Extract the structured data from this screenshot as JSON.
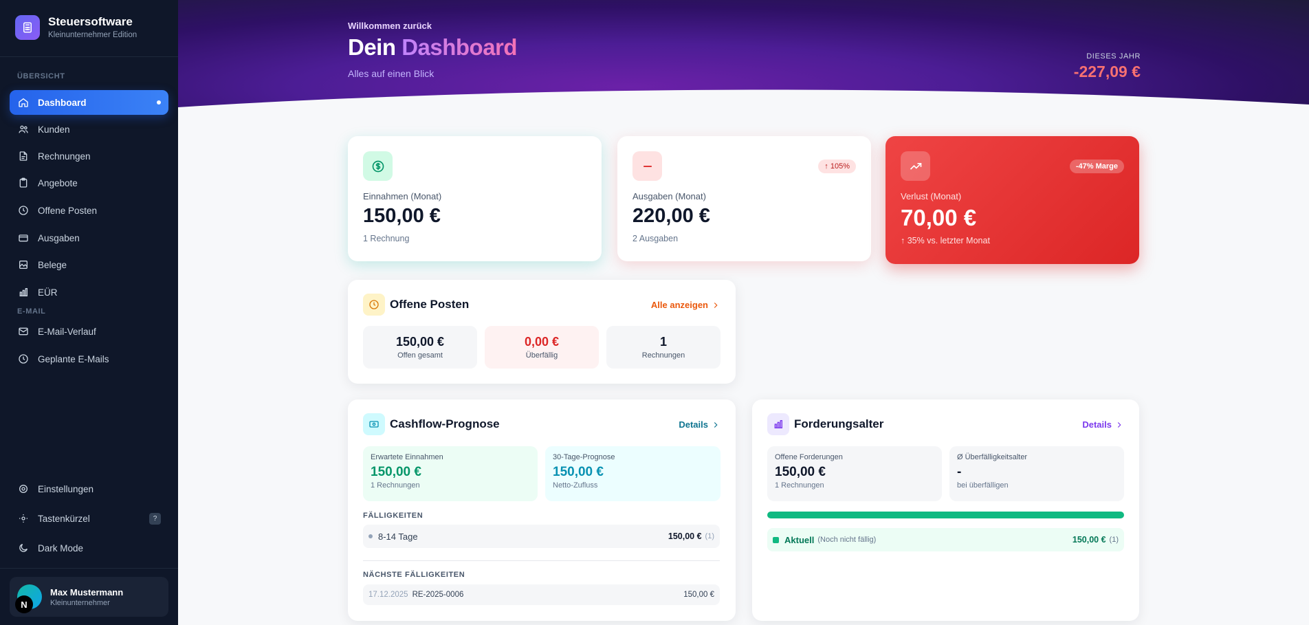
{
  "brand": {
    "title": "Steuersoftware",
    "subtitle": "Kleinunternehmer Edition"
  },
  "sidebar": {
    "section_overview": "ÜBERSICHT",
    "section_email": "E-MAIL",
    "items": [
      {
        "label": "Dashboard",
        "icon": "home-icon",
        "active": true
      },
      {
        "label": "Kunden",
        "icon": "users-icon"
      },
      {
        "label": "Rechnungen",
        "icon": "file-icon"
      },
      {
        "label": "Angebote",
        "icon": "clipboard-icon"
      },
      {
        "label": "Offene Posten",
        "icon": "clock-icon"
      },
      {
        "label": "Ausgaben",
        "icon": "wallet-icon"
      },
      {
        "label": "Belege",
        "icon": "image-icon"
      },
      {
        "label": "EÜR",
        "icon": "bar-chart-icon"
      }
    ],
    "email_items": [
      {
        "label": "E-Mail-Verlauf",
        "icon": "mail-icon"
      },
      {
        "label": "Geplante E-Mails",
        "icon": "clock-icon"
      }
    ],
    "bottom": [
      {
        "label": "Einstellungen",
        "icon": "gear-icon"
      },
      {
        "label": "Tastenkürzel",
        "icon": "sun-icon",
        "kbd": "?"
      },
      {
        "label": "Dark Mode",
        "icon": "moon-icon"
      }
    ],
    "user": {
      "name": "Max Mustermann",
      "role": "Kleinunternehmer",
      "avatar_letter": "N"
    }
  },
  "hero": {
    "welcome": "Willkommen zurück",
    "title_a": "Dein",
    "title_b": "Dashboard",
    "subtitle": "Alles auf einen Blick",
    "year_label": "DIESES JAHR",
    "year_value": "-227,09 €"
  },
  "kpis": {
    "income": {
      "label": "Einnahmen (Monat)",
      "value": "150,00 €",
      "note": "1 Rechnung"
    },
    "expense": {
      "label": "Ausgaben (Monat)",
      "value": "220,00 €",
      "note": "2 Ausgaben",
      "badge": "↑ 105%"
    },
    "loss": {
      "label": "Verlust (Monat)",
      "value": "70,00 €",
      "note": "↑ 35% vs. letzter Monat",
      "badge": "-47% Marge"
    }
  },
  "open_items": {
    "title": "Offene Posten",
    "link": "Alle anzeigen",
    "stats": [
      {
        "value": "150,00 €",
        "label": "Offen gesamt"
      },
      {
        "value": "0,00 €",
        "label": "Überfällig"
      },
      {
        "value": "1",
        "label": "Rechnungen"
      }
    ]
  },
  "cashflow": {
    "title": "Cashflow-Prognose",
    "link": "Details",
    "expected": {
      "label": "Erwartete Einnahmen",
      "value": "150,00 €",
      "sub": "1 Rechnungen"
    },
    "forecast": {
      "label": "30-Tage-Prognose",
      "value": "150,00 €",
      "sub": "Netto-Zufluss"
    },
    "due_label": "FÄLLIGKEITEN",
    "due_rows": [
      {
        "label": "8-14 Tage",
        "amount": "150,00 €",
        "count": "(1)"
      }
    ],
    "next_label": "NÄCHSTE FÄLLIGKEITEN",
    "next_rows": [
      {
        "date": "17.12.2025",
        "number": "RE-2025-0006",
        "amount": "150,00 €"
      }
    ]
  },
  "receivables": {
    "title": "Forderungsalter",
    "link": "Details",
    "open": {
      "label": "Offene Forderungen",
      "value": "150,00 €",
      "sub": "1 Rechnungen"
    },
    "avg": {
      "label": "Ø Überfälligkeitsalter",
      "value": "-",
      "sub": "bei überfälligen"
    },
    "progress_current": 1.0,
    "rows": [
      {
        "label": "Aktuell",
        "note": "(Noch nicht fällig)",
        "amount": "150,00 €",
        "count": "(1)"
      }
    ]
  },
  "colors": {
    "accent": "#2563eb",
    "income": "#0d9488",
    "loss": "#dc2626",
    "purple": "#7c3aed",
    "orange": "#ea580c"
  }
}
